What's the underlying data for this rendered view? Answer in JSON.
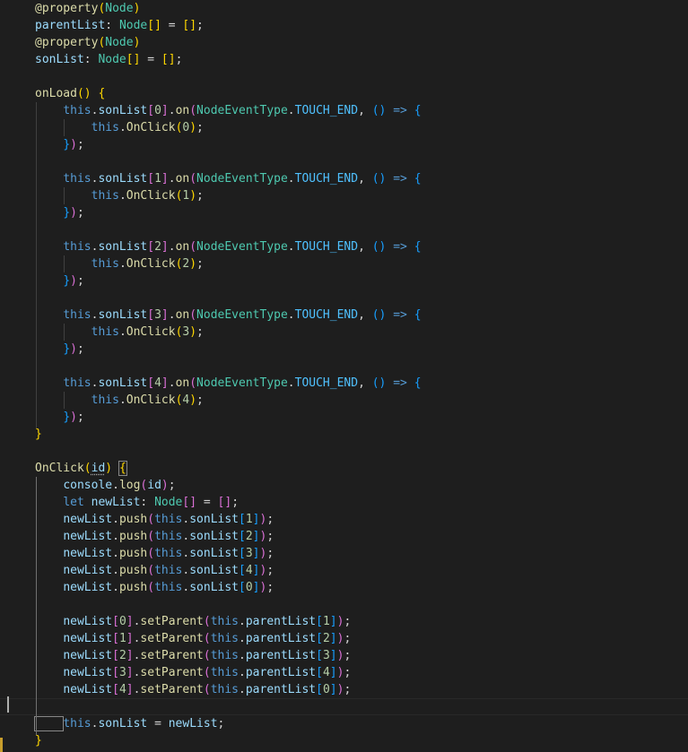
{
  "editor": {
    "theme": {
      "background": "#1e1e1e",
      "keyword": "#569cd6",
      "type": "#4ec9b0",
      "function": "#dcdcaa",
      "variable": "#9cdcfe",
      "enum_member": "#4fc1ff",
      "number": "#b5cea8",
      "bracket_level1": "#ffd700",
      "bracket_level2": "#da70d6",
      "bracket_level3": "#179fff"
    },
    "lines": [
      [
        [
          "dc",
          "@property"
        ],
        [
          "p1",
          "("
        ],
        [
          "ty",
          "Node"
        ],
        [
          "p1",
          ")"
        ]
      ],
      [
        [
          "vr",
          "parentList"
        ],
        [
          "op",
          ": "
        ],
        [
          "ty",
          "Node"
        ],
        [
          "p1",
          "[]"
        ],
        [
          "op",
          " = "
        ],
        [
          "p1",
          "[]"
        ],
        [
          "op",
          ";"
        ]
      ],
      [
        [
          "dc",
          "@property"
        ],
        [
          "p1",
          "("
        ],
        [
          "ty",
          "Node"
        ],
        [
          "p1",
          ")"
        ]
      ],
      [
        [
          "vr",
          "sonList"
        ],
        [
          "op",
          ": "
        ],
        [
          "ty",
          "Node"
        ],
        [
          "p1",
          "[]"
        ],
        [
          "op",
          " = "
        ],
        [
          "p1",
          "[]"
        ],
        [
          "op",
          ";"
        ]
      ],
      [],
      [
        [
          "fn",
          "onLoad"
        ],
        [
          "p1",
          "()"
        ],
        [
          "op",
          " "
        ],
        [
          "p1",
          "{"
        ]
      ],
      [
        [
          "op",
          "    "
        ],
        [
          "kw",
          "this"
        ],
        [
          "op",
          "."
        ],
        [
          "vr",
          "sonList"
        ],
        [
          "p2",
          "["
        ],
        [
          "nm",
          "0"
        ],
        [
          "p2",
          "]"
        ],
        [
          "op",
          "."
        ],
        [
          "fn",
          "on"
        ],
        [
          "p2",
          "("
        ],
        [
          "ty",
          "NodeEventType"
        ],
        [
          "op",
          "."
        ],
        [
          "en",
          "TOUCH_END"
        ],
        [
          "op",
          ", "
        ],
        [
          "p3",
          "()"
        ],
        [
          "op",
          " "
        ],
        [
          "kw",
          "=>"
        ],
        [
          "op",
          " "
        ],
        [
          "p3",
          "{"
        ]
      ],
      [
        [
          "op",
          "        "
        ],
        [
          "kw",
          "this"
        ],
        [
          "op",
          "."
        ],
        [
          "fn",
          "OnClick"
        ],
        [
          "p1",
          "("
        ],
        [
          "nm",
          "0"
        ],
        [
          "p1",
          ")"
        ],
        [
          "op",
          ";"
        ]
      ],
      [
        [
          "op",
          "    "
        ],
        [
          "p3",
          "}"
        ],
        [
          "p2",
          ")"
        ],
        [
          "op",
          ";"
        ]
      ],
      [],
      [
        [
          "op",
          "    "
        ],
        [
          "kw",
          "this"
        ],
        [
          "op",
          "."
        ],
        [
          "vr",
          "sonList"
        ],
        [
          "p2",
          "["
        ],
        [
          "nm",
          "1"
        ],
        [
          "p2",
          "]"
        ],
        [
          "op",
          "."
        ],
        [
          "fn",
          "on"
        ],
        [
          "p2",
          "("
        ],
        [
          "ty",
          "NodeEventType"
        ],
        [
          "op",
          "."
        ],
        [
          "en",
          "TOUCH_END"
        ],
        [
          "op",
          ", "
        ],
        [
          "p3",
          "()"
        ],
        [
          "op",
          " "
        ],
        [
          "kw",
          "=>"
        ],
        [
          "op",
          " "
        ],
        [
          "p3",
          "{"
        ]
      ],
      [
        [
          "op",
          "        "
        ],
        [
          "kw",
          "this"
        ],
        [
          "op",
          "."
        ],
        [
          "fn",
          "OnClick"
        ],
        [
          "p1",
          "("
        ],
        [
          "nm",
          "1"
        ],
        [
          "p1",
          ")"
        ],
        [
          "op",
          ";"
        ]
      ],
      [
        [
          "op",
          "    "
        ],
        [
          "p3",
          "}"
        ],
        [
          "p2",
          ")"
        ],
        [
          "op",
          ";"
        ]
      ],
      [],
      [
        [
          "op",
          "    "
        ],
        [
          "kw",
          "this"
        ],
        [
          "op",
          "."
        ],
        [
          "vr",
          "sonList"
        ],
        [
          "p2",
          "["
        ],
        [
          "nm",
          "2"
        ],
        [
          "p2",
          "]"
        ],
        [
          "op",
          "."
        ],
        [
          "fn",
          "on"
        ],
        [
          "p2",
          "("
        ],
        [
          "ty",
          "NodeEventType"
        ],
        [
          "op",
          "."
        ],
        [
          "en",
          "TOUCH_END"
        ],
        [
          "op",
          ", "
        ],
        [
          "p3",
          "()"
        ],
        [
          "op",
          " "
        ],
        [
          "kw",
          "=>"
        ],
        [
          "op",
          " "
        ],
        [
          "p3",
          "{"
        ]
      ],
      [
        [
          "op",
          "        "
        ],
        [
          "kw",
          "this"
        ],
        [
          "op",
          "."
        ],
        [
          "fn",
          "OnClick"
        ],
        [
          "p1",
          "("
        ],
        [
          "nm",
          "2"
        ],
        [
          "p1",
          ")"
        ],
        [
          "op",
          ";"
        ]
      ],
      [
        [
          "op",
          "    "
        ],
        [
          "p3",
          "}"
        ],
        [
          "p2",
          ")"
        ],
        [
          "op",
          ";"
        ]
      ],
      [],
      [
        [
          "op",
          "    "
        ],
        [
          "kw",
          "this"
        ],
        [
          "op",
          "."
        ],
        [
          "vr",
          "sonList"
        ],
        [
          "p2",
          "["
        ],
        [
          "nm",
          "3"
        ],
        [
          "p2",
          "]"
        ],
        [
          "op",
          "."
        ],
        [
          "fn",
          "on"
        ],
        [
          "p2",
          "("
        ],
        [
          "ty",
          "NodeEventType"
        ],
        [
          "op",
          "."
        ],
        [
          "en",
          "TOUCH_END"
        ],
        [
          "op",
          ", "
        ],
        [
          "p3",
          "()"
        ],
        [
          "op",
          " "
        ],
        [
          "kw",
          "=>"
        ],
        [
          "op",
          " "
        ],
        [
          "p3",
          "{"
        ]
      ],
      [
        [
          "op",
          "        "
        ],
        [
          "kw",
          "this"
        ],
        [
          "op",
          "."
        ],
        [
          "fn",
          "OnClick"
        ],
        [
          "p1",
          "("
        ],
        [
          "nm",
          "3"
        ],
        [
          "p1",
          ")"
        ],
        [
          "op",
          ";"
        ]
      ],
      [
        [
          "op",
          "    "
        ],
        [
          "p3",
          "}"
        ],
        [
          "p2",
          ")"
        ],
        [
          "op",
          ";"
        ]
      ],
      [],
      [
        [
          "op",
          "    "
        ],
        [
          "kw",
          "this"
        ],
        [
          "op",
          "."
        ],
        [
          "vr",
          "sonList"
        ],
        [
          "p2",
          "["
        ],
        [
          "nm",
          "4"
        ],
        [
          "p2",
          "]"
        ],
        [
          "op",
          "."
        ],
        [
          "fn",
          "on"
        ],
        [
          "p2",
          "("
        ],
        [
          "ty",
          "NodeEventType"
        ],
        [
          "op",
          "."
        ],
        [
          "en",
          "TOUCH_END"
        ],
        [
          "op",
          ", "
        ],
        [
          "p3",
          "()"
        ],
        [
          "op",
          " "
        ],
        [
          "kw",
          "=>"
        ],
        [
          "op",
          " "
        ],
        [
          "p3",
          "{"
        ]
      ],
      [
        [
          "op",
          "        "
        ],
        [
          "kw",
          "this"
        ],
        [
          "op",
          "."
        ],
        [
          "fn",
          "OnClick"
        ],
        [
          "p1",
          "("
        ],
        [
          "nm",
          "4"
        ],
        [
          "p1",
          ")"
        ],
        [
          "op",
          ";"
        ]
      ],
      [
        [
          "op",
          "    "
        ],
        [
          "p3",
          "}"
        ],
        [
          "p2",
          ")"
        ],
        [
          "op",
          ";"
        ]
      ],
      [
        [
          "p1",
          "}"
        ]
      ],
      [],
      [
        [
          "fn",
          "OnClick"
        ],
        [
          "p1",
          "("
        ],
        [
          "vr",
          "id"
        ],
        [
          "p1",
          ")"
        ],
        [
          "op",
          " "
        ],
        [
          "p1",
          "{"
        ]
      ],
      [
        [
          "op",
          "    "
        ],
        [
          "vr",
          "console"
        ],
        [
          "op",
          "."
        ],
        [
          "fn",
          "log"
        ],
        [
          "p2",
          "("
        ],
        [
          "vr",
          "id"
        ],
        [
          "p2",
          ")"
        ],
        [
          "op",
          ";"
        ]
      ],
      [
        [
          "op",
          "    "
        ],
        [
          "kw",
          "let"
        ],
        [
          "op",
          " "
        ],
        [
          "vr",
          "newList"
        ],
        [
          "op",
          ": "
        ],
        [
          "ty",
          "Node"
        ],
        [
          "p2",
          "[]"
        ],
        [
          "op",
          " = "
        ],
        [
          "p2",
          "[]"
        ],
        [
          "op",
          ";"
        ]
      ],
      [
        [
          "op",
          "    "
        ],
        [
          "vr",
          "newList"
        ],
        [
          "op",
          "."
        ],
        [
          "fn",
          "push"
        ],
        [
          "p2",
          "("
        ],
        [
          "kw",
          "this"
        ],
        [
          "op",
          "."
        ],
        [
          "vr",
          "sonList"
        ],
        [
          "p3",
          "["
        ],
        [
          "nm",
          "1"
        ],
        [
          "p3",
          "]"
        ],
        [
          "p2",
          ")"
        ],
        [
          "op",
          ";"
        ]
      ],
      [
        [
          "op",
          "    "
        ],
        [
          "vr",
          "newList"
        ],
        [
          "op",
          "."
        ],
        [
          "fn",
          "push"
        ],
        [
          "p2",
          "("
        ],
        [
          "kw",
          "this"
        ],
        [
          "op",
          "."
        ],
        [
          "vr",
          "sonList"
        ],
        [
          "p3",
          "["
        ],
        [
          "nm",
          "2"
        ],
        [
          "p3",
          "]"
        ],
        [
          "p2",
          ")"
        ],
        [
          "op",
          ";"
        ]
      ],
      [
        [
          "op",
          "    "
        ],
        [
          "vr",
          "newList"
        ],
        [
          "op",
          "."
        ],
        [
          "fn",
          "push"
        ],
        [
          "p2",
          "("
        ],
        [
          "kw",
          "this"
        ],
        [
          "op",
          "."
        ],
        [
          "vr",
          "sonList"
        ],
        [
          "p3",
          "["
        ],
        [
          "nm",
          "3"
        ],
        [
          "p3",
          "]"
        ],
        [
          "p2",
          ")"
        ],
        [
          "op",
          ";"
        ]
      ],
      [
        [
          "op",
          "    "
        ],
        [
          "vr",
          "newList"
        ],
        [
          "op",
          "."
        ],
        [
          "fn",
          "push"
        ],
        [
          "p2",
          "("
        ],
        [
          "kw",
          "this"
        ],
        [
          "op",
          "."
        ],
        [
          "vr",
          "sonList"
        ],
        [
          "p3",
          "["
        ],
        [
          "nm",
          "4"
        ],
        [
          "p3",
          "]"
        ],
        [
          "p2",
          ")"
        ],
        [
          "op",
          ";"
        ]
      ],
      [
        [
          "op",
          "    "
        ],
        [
          "vr",
          "newList"
        ],
        [
          "op",
          "."
        ],
        [
          "fn",
          "push"
        ],
        [
          "p2",
          "("
        ],
        [
          "kw",
          "this"
        ],
        [
          "op",
          "."
        ],
        [
          "vr",
          "sonList"
        ],
        [
          "p3",
          "["
        ],
        [
          "nm",
          "0"
        ],
        [
          "p3",
          "]"
        ],
        [
          "p2",
          ")"
        ],
        [
          "op",
          ";"
        ]
      ],
      [],
      [
        [
          "op",
          "    "
        ],
        [
          "vr",
          "newList"
        ],
        [
          "p2",
          "["
        ],
        [
          "nm",
          "0"
        ],
        [
          "p2",
          "]"
        ],
        [
          "op",
          "."
        ],
        [
          "fn",
          "setParent"
        ],
        [
          "p2",
          "("
        ],
        [
          "kw",
          "this"
        ],
        [
          "op",
          "."
        ],
        [
          "vr",
          "parentList"
        ],
        [
          "p3",
          "["
        ],
        [
          "nm",
          "1"
        ],
        [
          "p3",
          "]"
        ],
        [
          "p2",
          ")"
        ],
        [
          "op",
          ";"
        ]
      ],
      [
        [
          "op",
          "    "
        ],
        [
          "vr",
          "newList"
        ],
        [
          "p2",
          "["
        ],
        [
          "nm",
          "1"
        ],
        [
          "p2",
          "]"
        ],
        [
          "op",
          "."
        ],
        [
          "fn",
          "setParent"
        ],
        [
          "p2",
          "("
        ],
        [
          "kw",
          "this"
        ],
        [
          "op",
          "."
        ],
        [
          "vr",
          "parentList"
        ],
        [
          "p3",
          "["
        ],
        [
          "nm",
          "2"
        ],
        [
          "p3",
          "]"
        ],
        [
          "p2",
          ")"
        ],
        [
          "op",
          ";"
        ]
      ],
      [
        [
          "op",
          "    "
        ],
        [
          "vr",
          "newList"
        ],
        [
          "p2",
          "["
        ],
        [
          "nm",
          "2"
        ],
        [
          "p2",
          "]"
        ],
        [
          "op",
          "."
        ],
        [
          "fn",
          "setParent"
        ],
        [
          "p2",
          "("
        ],
        [
          "kw",
          "this"
        ],
        [
          "op",
          "."
        ],
        [
          "vr",
          "parentList"
        ],
        [
          "p3",
          "["
        ],
        [
          "nm",
          "3"
        ],
        [
          "p3",
          "]"
        ],
        [
          "p2",
          ")"
        ],
        [
          "op",
          ";"
        ]
      ],
      [
        [
          "op",
          "    "
        ],
        [
          "vr",
          "newList"
        ],
        [
          "p2",
          "["
        ],
        [
          "nm",
          "3"
        ],
        [
          "p2",
          "]"
        ],
        [
          "op",
          "."
        ],
        [
          "fn",
          "setParent"
        ],
        [
          "p2",
          "("
        ],
        [
          "kw",
          "this"
        ],
        [
          "op",
          "."
        ],
        [
          "vr",
          "parentList"
        ],
        [
          "p3",
          "["
        ],
        [
          "nm",
          "4"
        ],
        [
          "p3",
          "]"
        ],
        [
          "p2",
          ")"
        ],
        [
          "op",
          ";"
        ]
      ],
      [
        [
          "op",
          "    "
        ],
        [
          "vr",
          "newList"
        ],
        [
          "p2",
          "["
        ],
        [
          "nm",
          "4"
        ],
        [
          "p2",
          "]"
        ],
        [
          "op",
          "."
        ],
        [
          "fn",
          "setParent"
        ],
        [
          "p2",
          "("
        ],
        [
          "kw",
          "this"
        ],
        [
          "op",
          "."
        ],
        [
          "vr",
          "parentList"
        ],
        [
          "p3",
          "["
        ],
        [
          "nm",
          "0"
        ],
        [
          "p3",
          "]"
        ],
        [
          "p2",
          ")"
        ],
        [
          "op",
          ";"
        ]
      ],
      [],
      [
        [
          "op",
          "    "
        ],
        [
          "kw",
          "this"
        ],
        [
          "op",
          "."
        ],
        [
          "vr",
          "sonList"
        ],
        [
          "op",
          " = "
        ],
        [
          "vr",
          "newList"
        ],
        [
          "op",
          ";"
        ]
      ],
      [
        [
          "p1",
          "}"
        ]
      ]
    ]
  }
}
